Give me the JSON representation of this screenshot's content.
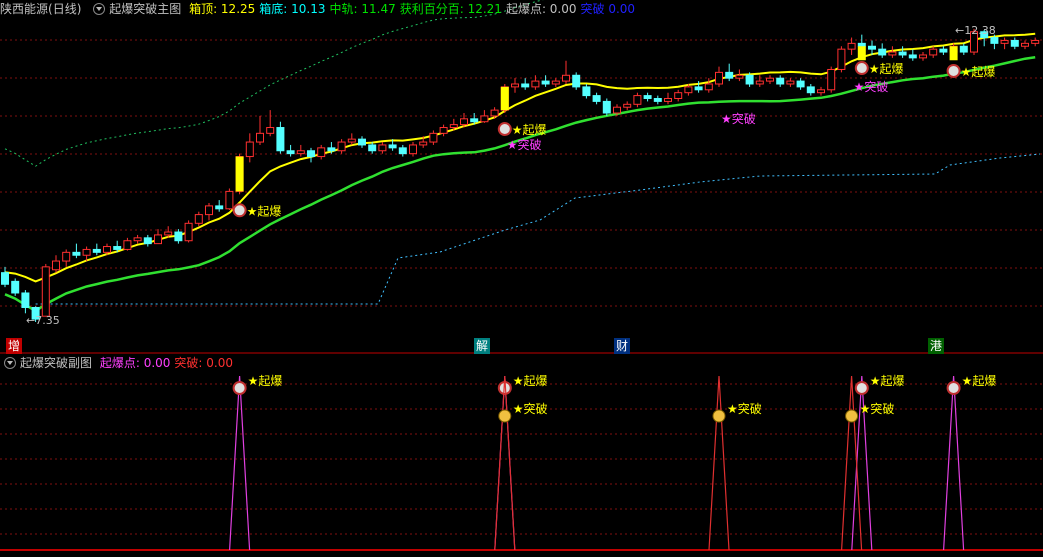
{
  "main_header": {
    "stock": "陕西能源",
    "period": "(日线)",
    "indicator": "起爆突破主图",
    "items": [
      {
        "label": "箱顶:",
        "value": "12.25",
        "color": "#ffff00"
      },
      {
        "label": "箱底:",
        "value": "10.13",
        "color": "#00ffff"
      },
      {
        "label": "中轨:",
        "value": "11.47",
        "color": "#00e000"
      },
      {
        "label": "获利百分百:",
        "value": "12.21",
        "color": "#00e000"
      },
      {
        "label": "起爆点:",
        "value": "0.00",
        "color": "#c0c0c0"
      },
      {
        "label": "突破",
        "value": "0.00",
        "color": "#2020ff"
      }
    ]
  },
  "sub_header": {
    "indicator": "起爆突破副图",
    "items": [
      {
        "label": "起爆点:",
        "value": "0.00",
        "color": "#ff40ff"
      },
      {
        "label": "突破:",
        "value": "0.00",
        "color": "#ff3030"
      }
    ]
  },
  "price_labels": {
    "low": "←7.35",
    "high": "←12.38"
  },
  "event_tags": [
    {
      "text": "增",
      "bg": "#c00000"
    },
    {
      "text": "解",
      "bg": "#008080"
    },
    {
      "text": "财",
      "bg": "#003080"
    },
    {
      "text": "港",
      "bg": "#006000"
    }
  ],
  "signals": {
    "qibao": "★起爆",
    "tupo": "★突破"
  },
  "colors": {
    "up": "#ff3030",
    "down": "#54ffff",
    "box_top": "#ffff00",
    "mid_line": "#30e030",
    "upper_dash": "#20c060",
    "lower_dash": "#40c0ff",
    "grid": "#801010",
    "separator": "#c00000",
    "qibao_mark": "#ffff00",
    "tupo_mark": "#ff40ff"
  },
  "chart_data": {
    "type": "candlestick",
    "price_range": [
      7.35,
      12.38
    ],
    "candles": [
      {
        "o": 8.2,
        "c": 8.0,
        "h": 8.3,
        "l": 7.95
      },
      {
        "o": 8.05,
        "c": 7.85,
        "h": 8.1,
        "l": 7.8
      },
      {
        "o": 7.85,
        "c": 7.6,
        "h": 7.9,
        "l": 7.5
      },
      {
        "o": 7.6,
        "c": 7.4,
        "h": 7.62,
        "l": 7.35
      },
      {
        "o": 7.45,
        "c": 8.3,
        "h": 8.35,
        "l": 7.45
      },
      {
        "o": 8.25,
        "c": 8.4,
        "h": 8.5,
        "l": 8.2
      },
      {
        "o": 8.4,
        "c": 8.55,
        "h": 8.6,
        "l": 8.3
      },
      {
        "o": 8.55,
        "c": 8.5,
        "h": 8.7,
        "l": 8.45
      },
      {
        "o": 8.5,
        "c": 8.6,
        "h": 8.65,
        "l": 8.4
      },
      {
        "o": 8.6,
        "c": 8.55,
        "h": 8.7,
        "l": 8.5
      },
      {
        "o": 8.55,
        "c": 8.65,
        "h": 8.7,
        "l": 8.5
      },
      {
        "o": 8.65,
        "c": 8.6,
        "h": 8.75,
        "l": 8.55
      },
      {
        "o": 8.6,
        "c": 8.75,
        "h": 8.8,
        "l": 8.58
      },
      {
        "o": 8.75,
        "c": 8.8,
        "h": 8.85,
        "l": 8.7
      },
      {
        "o": 8.8,
        "c": 8.7,
        "h": 8.85,
        "l": 8.65
      },
      {
        "o": 8.7,
        "c": 8.85,
        "h": 8.95,
        "l": 8.7
      },
      {
        "o": 8.85,
        "c": 8.9,
        "h": 9.0,
        "l": 8.8
      },
      {
        "o": 8.9,
        "c": 8.75,
        "h": 8.95,
        "l": 8.7
      },
      {
        "o": 8.75,
        "c": 9.05,
        "h": 9.1,
        "l": 8.72
      },
      {
        "o": 9.05,
        "c": 9.2,
        "h": 9.25,
        "l": 9.0
      },
      {
        "o": 9.2,
        "c": 9.35,
        "h": 9.4,
        "l": 9.1
      },
      {
        "o": 9.35,
        "c": 9.3,
        "h": 9.45,
        "l": 9.25
      },
      {
        "o": 9.3,
        "c": 9.6,
        "h": 9.65,
        "l": 9.28
      },
      {
        "o": 9.6,
        "c": 10.2,
        "h": 10.25,
        "l": 9.55
      },
      {
        "o": 10.2,
        "c": 10.45,
        "h": 10.6,
        "l": 10.1
      },
      {
        "o": 10.45,
        "c": 10.6,
        "h": 10.9,
        "l": 10.4
      },
      {
        "o": 10.6,
        "c": 10.7,
        "h": 11.0,
        "l": 10.55
      },
      {
        "o": 10.7,
        "c": 10.3,
        "h": 10.8,
        "l": 10.25
      },
      {
        "o": 10.3,
        "c": 10.25,
        "h": 10.4,
        "l": 10.2
      },
      {
        "o": 10.25,
        "c": 10.3,
        "h": 10.4,
        "l": 10.2
      },
      {
        "o": 10.3,
        "c": 10.2,
        "h": 10.35,
        "l": 10.1
      },
      {
        "o": 10.2,
        "c": 10.35,
        "h": 10.4,
        "l": 10.15
      },
      {
        "o": 10.35,
        "c": 10.3,
        "h": 10.45,
        "l": 10.25
      },
      {
        "o": 10.3,
        "c": 10.45,
        "h": 10.5,
        "l": 10.25
      },
      {
        "o": 10.45,
        "c": 10.5,
        "h": 10.6,
        "l": 10.4
      },
      {
        "o": 10.5,
        "c": 10.4,
        "h": 10.55,
        "l": 10.35
      },
      {
        "o": 10.4,
        "c": 10.3,
        "h": 10.45,
        "l": 10.25
      },
      {
        "o": 10.3,
        "c": 10.4,
        "h": 10.45,
        "l": 10.25
      },
      {
        "o": 10.4,
        "c": 10.35,
        "h": 10.5,
        "l": 10.3
      },
      {
        "o": 10.35,
        "c": 10.25,
        "h": 10.4,
        "l": 10.2
      },
      {
        "o": 10.25,
        "c": 10.4,
        "h": 10.45,
        "l": 10.2
      },
      {
        "o": 10.4,
        "c": 10.45,
        "h": 10.55,
        "l": 10.35
      },
      {
        "o": 10.45,
        "c": 10.6,
        "h": 10.65,
        "l": 10.4
      },
      {
        "o": 10.6,
        "c": 10.7,
        "h": 10.75,
        "l": 10.55
      },
      {
        "o": 10.7,
        "c": 10.75,
        "h": 10.85,
        "l": 10.65
      },
      {
        "o": 10.75,
        "c": 10.85,
        "h": 10.95,
        "l": 10.7
      },
      {
        "o": 10.85,
        "c": 10.8,
        "h": 10.95,
        "l": 10.75
      },
      {
        "o": 10.8,
        "c": 10.9,
        "h": 11.0,
        "l": 10.78
      },
      {
        "o": 10.9,
        "c": 11.0,
        "h": 11.05,
        "l": 10.85
      },
      {
        "o": 11.0,
        "c": 11.4,
        "h": 11.45,
        "l": 10.95
      },
      {
        "o": 11.4,
        "c": 11.45,
        "h": 11.55,
        "l": 11.3
      },
      {
        "o": 11.45,
        "c": 11.4,
        "h": 11.55,
        "l": 11.35
      },
      {
        "o": 11.4,
        "c": 11.5,
        "h": 11.6,
        "l": 11.35
      },
      {
        "o": 11.5,
        "c": 11.45,
        "h": 11.6,
        "l": 11.4
      },
      {
        "o": 11.45,
        "c": 11.5,
        "h": 11.55,
        "l": 11.4
      },
      {
        "o": 11.5,
        "c": 11.6,
        "h": 11.85,
        "l": 11.45
      },
      {
        "o": 11.6,
        "c": 11.4,
        "h": 11.65,
        "l": 11.35
      },
      {
        "o": 11.4,
        "c": 11.25,
        "h": 11.45,
        "l": 11.2
      },
      {
        "o": 11.25,
        "c": 11.15,
        "h": 11.3,
        "l": 11.1
      },
      {
        "o": 11.15,
        "c": 10.95,
        "h": 11.2,
        "l": 10.9
      },
      {
        "o": 10.95,
        "c": 11.05,
        "h": 11.1,
        "l": 10.9
      },
      {
        "o": 11.05,
        "c": 11.1,
        "h": 11.15,
        "l": 11.0
      },
      {
        "o": 11.1,
        "c": 11.25,
        "h": 11.3,
        "l": 11.05
      },
      {
        "o": 11.25,
        "c": 11.2,
        "h": 11.3,
        "l": 11.15
      },
      {
        "o": 11.2,
        "c": 11.15,
        "h": 11.25,
        "l": 11.1
      },
      {
        "o": 11.15,
        "c": 11.2,
        "h": 11.3,
        "l": 11.1
      },
      {
        "o": 11.2,
        "c": 11.3,
        "h": 11.35,
        "l": 11.15
      },
      {
        "o": 11.3,
        "c": 11.4,
        "h": 11.45,
        "l": 11.25
      },
      {
        "o": 11.4,
        "c": 11.35,
        "h": 11.5,
        "l": 11.3
      },
      {
        "o": 11.35,
        "c": 11.45,
        "h": 11.55,
        "l": 11.3
      },
      {
        "o": 11.45,
        "c": 11.65,
        "h": 11.75,
        "l": 11.4
      },
      {
        "o": 11.65,
        "c": 11.55,
        "h": 11.8,
        "l": 11.5
      },
      {
        "o": 11.55,
        "c": 11.6,
        "h": 11.7,
        "l": 11.5
      },
      {
        "o": 11.6,
        "c": 11.45,
        "h": 11.65,
        "l": 11.4
      },
      {
        "o": 11.45,
        "c": 11.5,
        "h": 11.6,
        "l": 11.4
      },
      {
        "o": 11.5,
        "c": 11.55,
        "h": 11.6,
        "l": 11.45
      },
      {
        "o": 11.55,
        "c": 11.45,
        "h": 11.6,
        "l": 11.4
      },
      {
        "o": 11.45,
        "c": 11.5,
        "h": 11.55,
        "l": 11.4
      },
      {
        "o": 11.5,
        "c": 11.4,
        "h": 11.55,
        "l": 11.35
      },
      {
        "o": 11.4,
        "c": 11.3,
        "h": 11.45,
        "l": 11.25
      },
      {
        "o": 11.3,
        "c": 11.35,
        "h": 11.4,
        "l": 11.25
      },
      {
        "o": 11.35,
        "c": 11.7,
        "h": 11.75,
        "l": 11.3
      },
      {
        "o": 11.7,
        "c": 12.05,
        "h": 12.1,
        "l": 11.65
      },
      {
        "o": 12.05,
        "c": 12.15,
        "h": 12.25,
        "l": 11.95
      },
      {
        "o": 12.15,
        "c": 12.1,
        "h": 12.3,
        "l": 12.0
      },
      {
        "o": 12.1,
        "c": 12.05,
        "h": 12.2,
        "l": 11.95
      },
      {
        "o": 12.05,
        "c": 11.95,
        "h": 12.15,
        "l": 11.9
      },
      {
        "o": 11.95,
        "c": 12.0,
        "h": 12.1,
        "l": 11.9
      },
      {
        "o": 12.0,
        "c": 11.95,
        "h": 12.1,
        "l": 11.9
      },
      {
        "o": 11.95,
        "c": 11.9,
        "h": 12.05,
        "l": 11.85
      },
      {
        "o": 11.9,
        "c": 11.95,
        "h": 12.0,
        "l": 11.85
      },
      {
        "o": 11.95,
        "c": 12.05,
        "h": 12.1,
        "l": 11.9
      },
      {
        "o": 12.05,
        "c": 12.0,
        "h": 12.1,
        "l": 11.95
      },
      {
        "o": 12.0,
        "c": 12.1,
        "h": 12.15,
        "l": 11.95
      },
      {
        "o": 12.1,
        "c": 12.0,
        "h": 12.15,
        "l": 11.95
      },
      {
        "o": 12.0,
        "c": 12.35,
        "h": 12.4,
        "l": 11.95
      },
      {
        "o": 12.35,
        "c": 12.25,
        "h": 12.38,
        "l": 12.1
      },
      {
        "o": 12.25,
        "c": 12.15,
        "h": 12.3,
        "l": 12.05
      },
      {
        "o": 12.15,
        "c": 12.2,
        "h": 12.25,
        "l": 12.05
      },
      {
        "o": 12.2,
        "c": 12.1,
        "h": 12.25,
        "l": 12.05
      },
      {
        "o": 12.1,
        "c": 12.15,
        "h": 12.2,
        "l": 12.05
      },
      {
        "o": 12.15,
        "c": 12.2,
        "h": 12.25,
        "l": 12.1
      }
    ],
    "qibao_bars": [
      23,
      49,
      84,
      93
    ],
    "tupo_bars": [
      49,
      70,
      83
    ]
  }
}
